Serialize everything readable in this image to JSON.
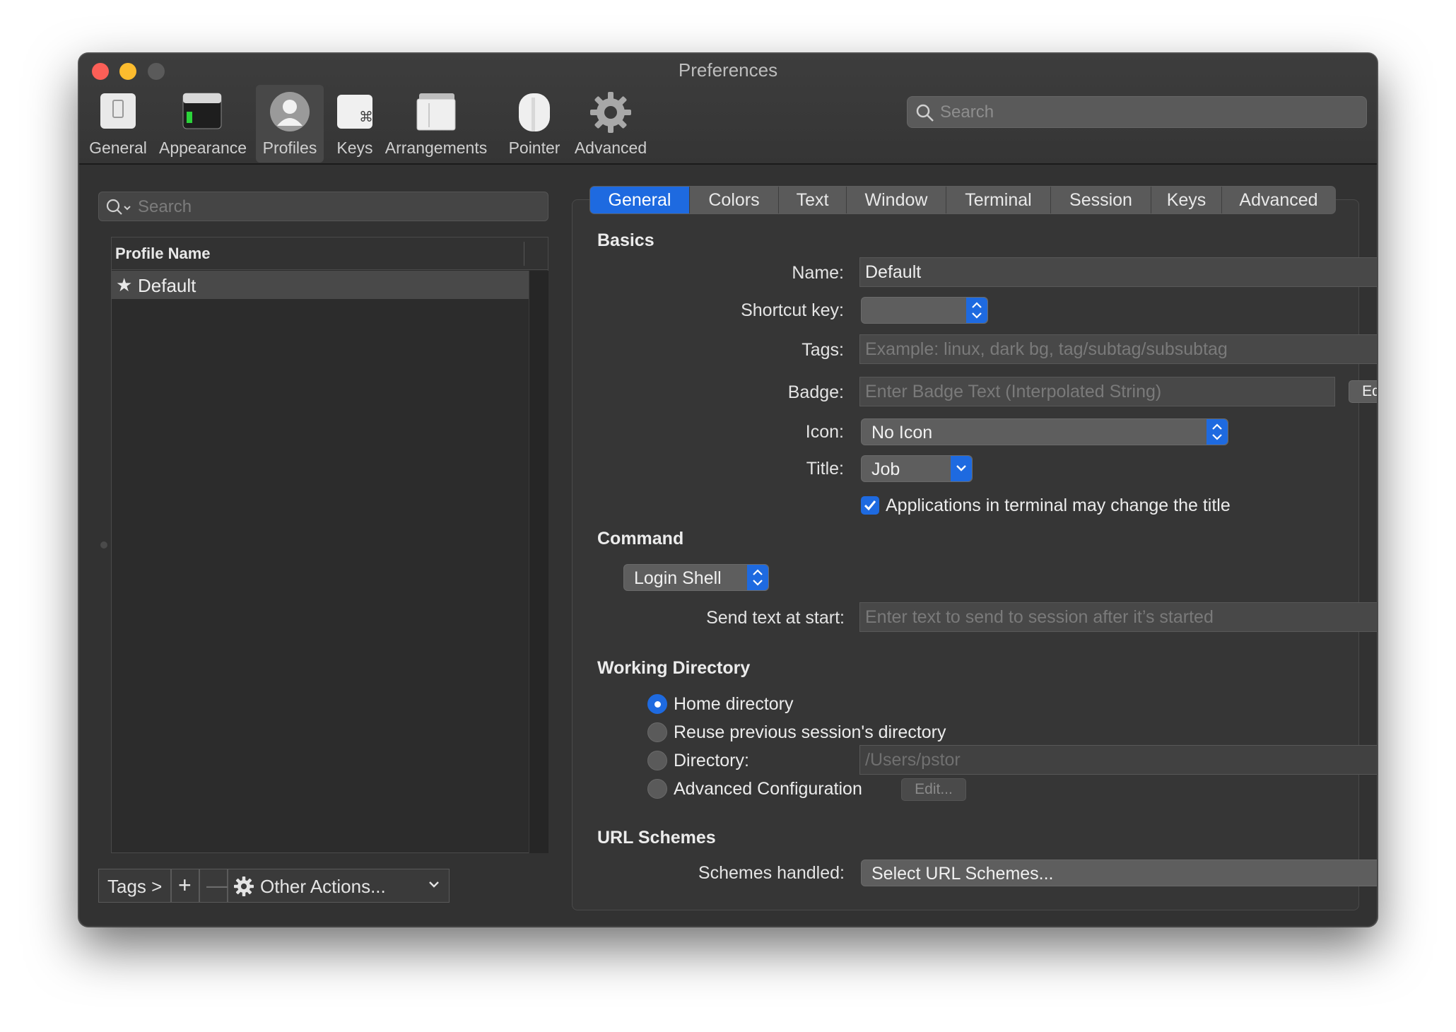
{
  "window": {
    "title": "Preferences"
  },
  "toolbar": {
    "items": [
      {
        "label": "General",
        "icon": "general-icon"
      },
      {
        "label": "Appearance",
        "icon": "appearance-icon"
      },
      {
        "label": "Profiles",
        "icon": "profiles-icon",
        "selected": true
      },
      {
        "label": "Keys",
        "icon": "keys-icon"
      },
      {
        "label": "Arrangements",
        "icon": "arrangements-icon"
      },
      {
        "label": "Pointer",
        "icon": "pointer-icon"
      },
      {
        "label": "Advanced",
        "icon": "gear-icon"
      }
    ],
    "search_placeholder": "Search"
  },
  "profiles": {
    "search_placeholder": "Search",
    "column_header": "Profile Name",
    "rows": [
      {
        "name": "Default",
        "is_default": true
      }
    ],
    "bottom": {
      "tags_label": "Tags >",
      "add_label": "+",
      "remove_label": "—",
      "other_actions_label": "Other Actions..."
    }
  },
  "tabs": [
    {
      "label": "General",
      "active": true
    },
    {
      "label": "Colors"
    },
    {
      "label": "Text"
    },
    {
      "label": "Window"
    },
    {
      "label": "Terminal"
    },
    {
      "label": "Session"
    },
    {
      "label": "Keys"
    },
    {
      "label": "Advanced"
    }
  ],
  "general": {
    "basics": {
      "heading": "Basics",
      "name_label": "Name:",
      "name_value": "Default",
      "shortcut_label": "Shortcut key:",
      "shortcut_value": "",
      "tags_label": "Tags:",
      "tags_placeholder": "Example: linux, dark bg, tag/subtag/subsubtag",
      "badge_label": "Badge:",
      "badge_placeholder": "Enter Badge Text (Interpolated String)",
      "badge_edit": "Edit...",
      "icon_label": "Icon:",
      "icon_value": "No Icon",
      "title_label": "Title:",
      "title_value": "Job",
      "help": "?",
      "apps_change_title_label": "Applications in terminal may change the title",
      "apps_change_title_checked": true
    },
    "command": {
      "heading": "Command",
      "shell_value": "Login Shell",
      "send_text_label": "Send text at start:",
      "send_text_placeholder": "Enter text to send to session after it’s started"
    },
    "working_directory": {
      "heading": "Working Directory",
      "options": [
        {
          "label": "Home directory",
          "selected": true
        },
        {
          "label": "Reuse previous session's directory"
        },
        {
          "label": "Directory:"
        },
        {
          "label": "Advanced Configuration"
        }
      ],
      "directory_value": "/Users/pstor",
      "advanced_edit": "Edit..."
    },
    "url_schemes": {
      "heading": "URL Schemes",
      "schemes_label": "Schemes handled:",
      "schemes_value": "Select URL Schemes..."
    }
  },
  "colors": {
    "accent": "#1e6ae0",
    "window_bg": "#323232",
    "close": "#fc5f57",
    "minimize": "#fdbc2e"
  }
}
